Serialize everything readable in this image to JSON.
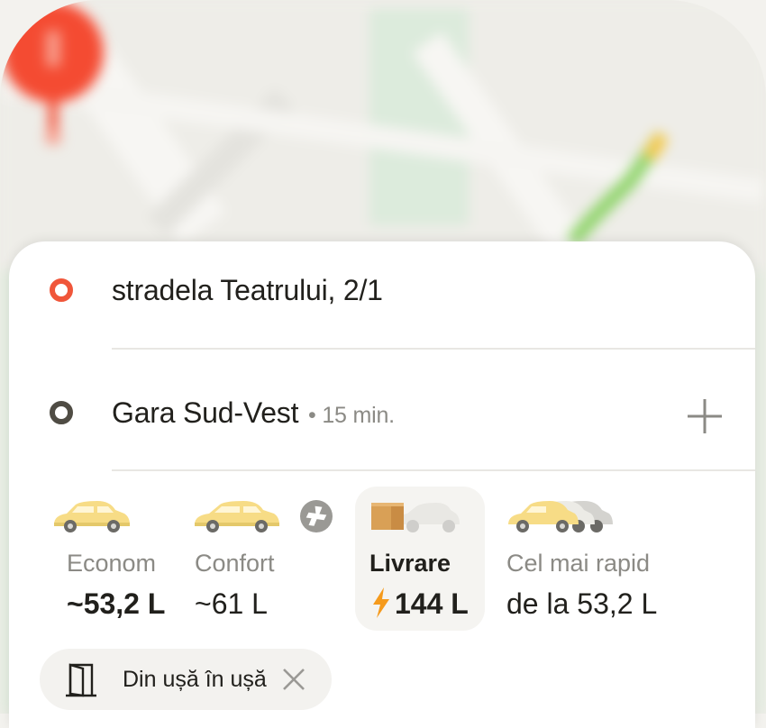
{
  "route": {
    "from": {
      "address": "stradela Teatrului, 2/1"
    },
    "to": {
      "address": "Gara Sud-Vest",
      "eta": " • 15 min."
    },
    "add_stop_icon": "plus-icon"
  },
  "tariffs": [
    {
      "name": "Econom",
      "price": "~53,2 L",
      "selected": false
    },
    {
      "name": "Confort",
      "price": "~61 L",
      "selected": false,
      "badge_icon": "plus-badge-icon"
    },
    {
      "name": "Livrare",
      "price": "144 L",
      "selected": true,
      "price_icon": "lightning-icon"
    },
    {
      "name": "Cel mai rapid",
      "price": "de la 53,2 L",
      "selected": false
    }
  ],
  "chip": {
    "label": "Din ușă în ușă",
    "icon": "door-icon",
    "close_icon": "close-icon"
  },
  "colors": {
    "origin": "#f0563a",
    "destination": "#4f4c44",
    "pin": "#f44b32",
    "taxi": "#f7dc86",
    "bolt": "#f59a1c"
  }
}
